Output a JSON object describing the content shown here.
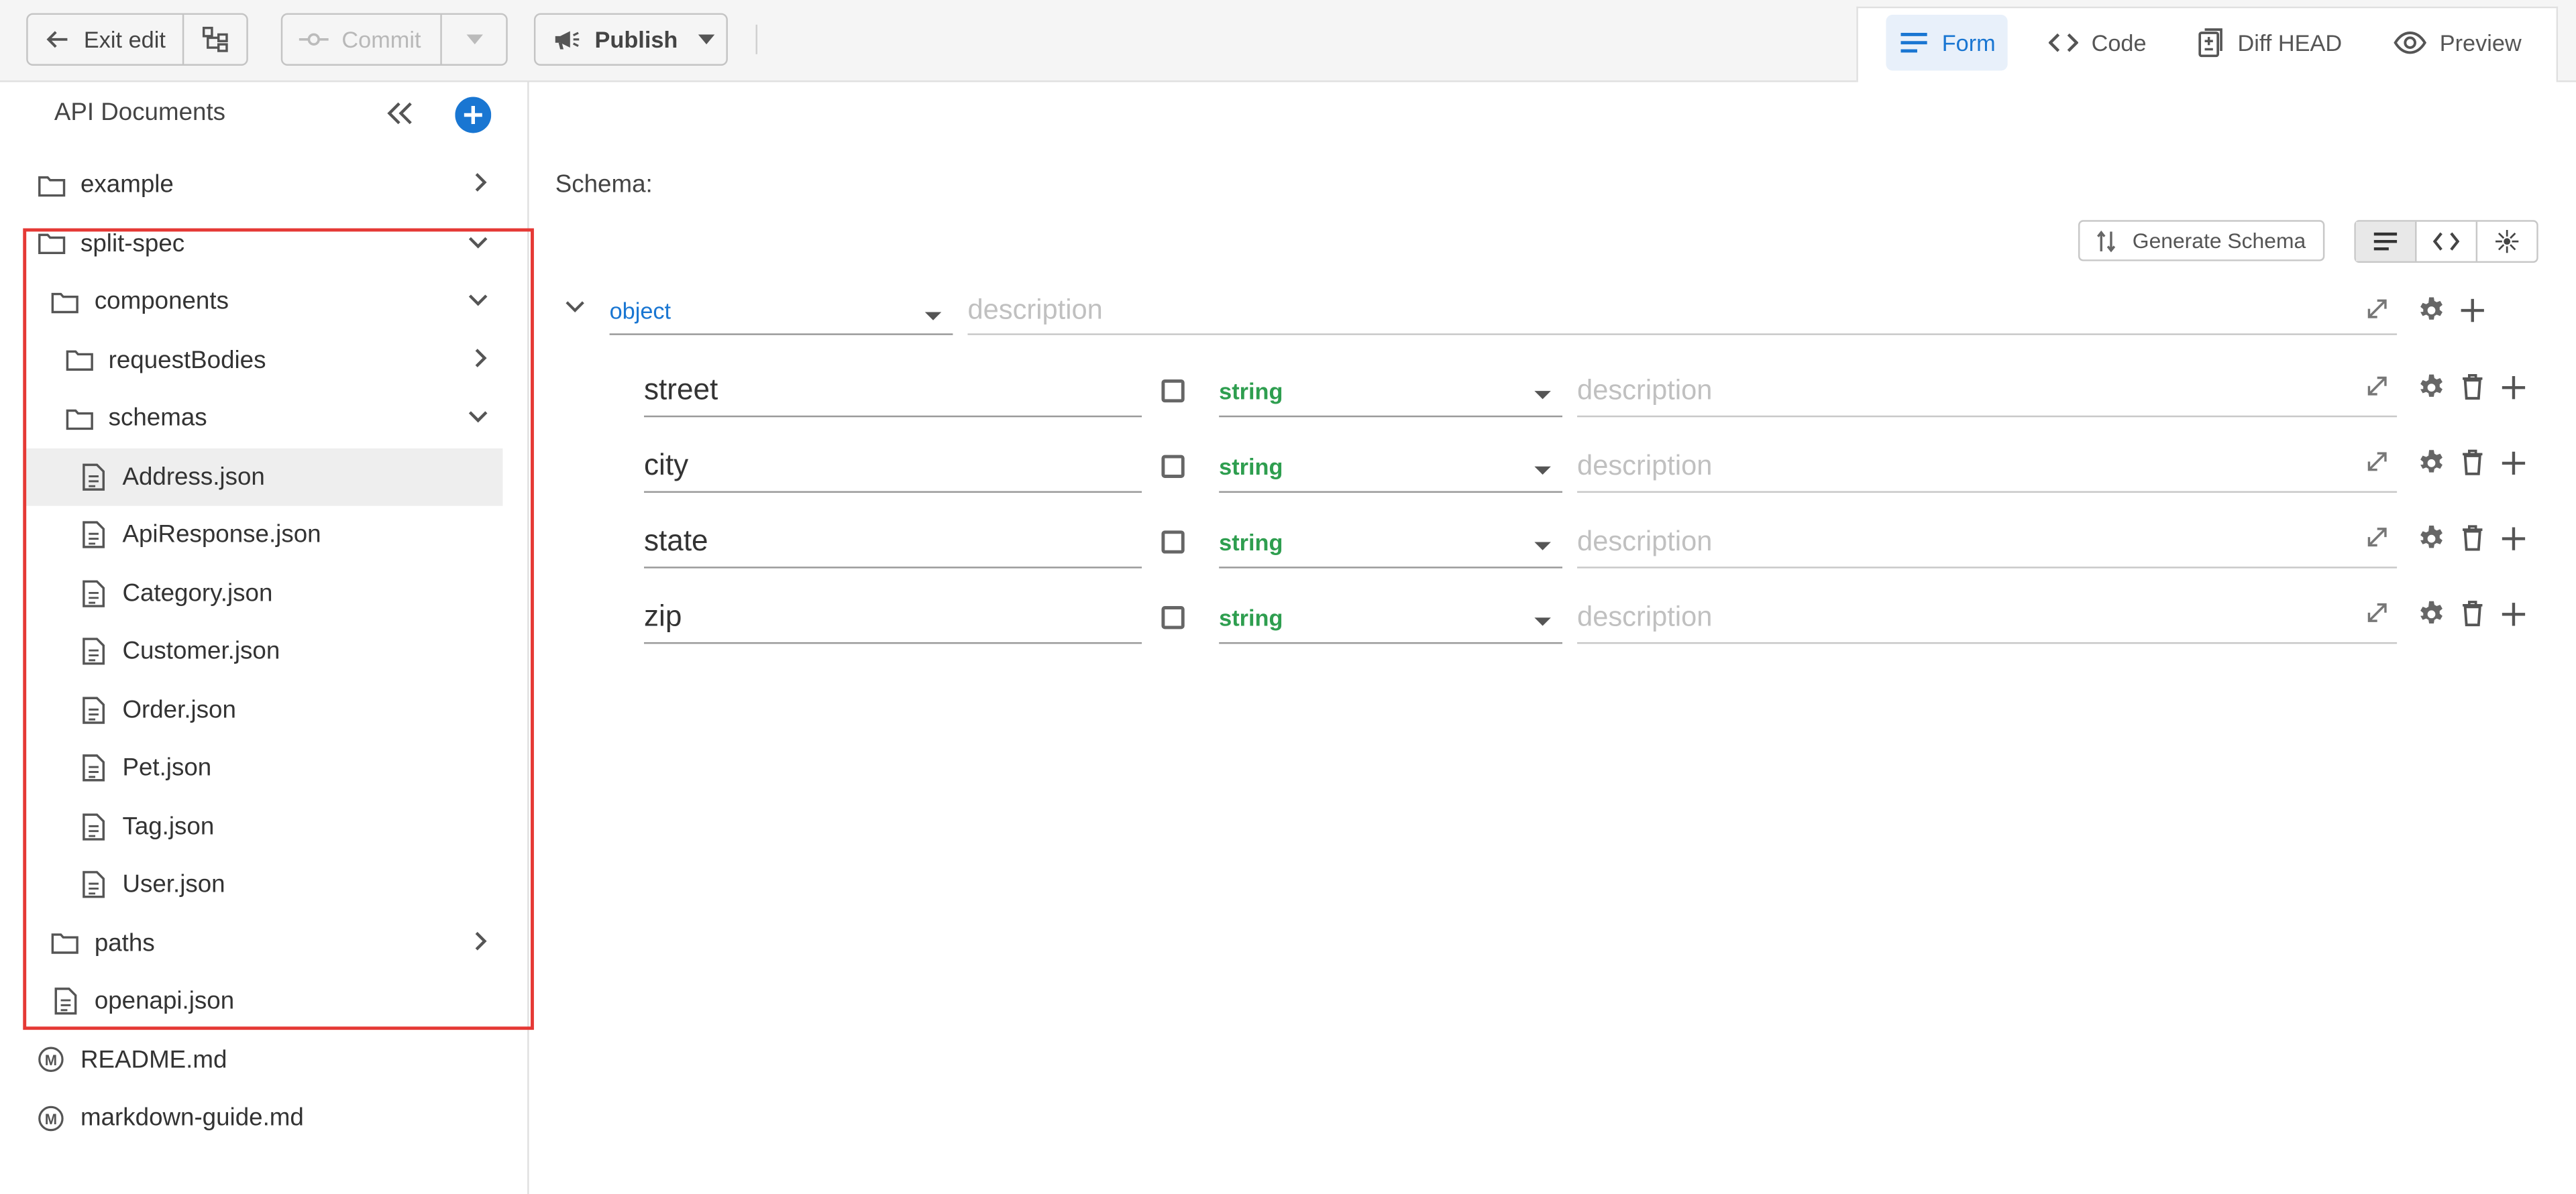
{
  "toolbar": {
    "exit_edit_label": "Exit edit",
    "commit_label": "Commit",
    "publish_label": "Publish"
  },
  "view_tabs": [
    {
      "label": "Form",
      "icon": "lines-icon",
      "active": true
    },
    {
      "label": "Code",
      "icon": "code-icon",
      "active": false
    },
    {
      "label": "Diff HEAD",
      "icon": "diff-icon",
      "active": false
    },
    {
      "label": "Preview",
      "icon": "eye-icon",
      "active": false
    }
  ],
  "sidebar": {
    "title": "API Documents",
    "tree": [
      {
        "label": "example",
        "type": "folder",
        "expanded": false
      },
      {
        "label": "split-spec",
        "type": "folder",
        "expanded": true
      },
      {
        "label": "components",
        "type": "folder",
        "expanded": true
      },
      {
        "label": "requestBodies",
        "type": "folder",
        "expanded": false
      },
      {
        "label": "schemas",
        "type": "folder",
        "expanded": true
      },
      {
        "label": "Address.json",
        "type": "file",
        "selected": true
      },
      {
        "label": "ApiResponse.json",
        "type": "file"
      },
      {
        "label": "Category.json",
        "type": "file"
      },
      {
        "label": "Customer.json",
        "type": "file"
      },
      {
        "label": "Order.json",
        "type": "file"
      },
      {
        "label": "Pet.json",
        "type": "file"
      },
      {
        "label": "Tag.json",
        "type": "file"
      },
      {
        "label": "User.json",
        "type": "file"
      },
      {
        "label": "paths",
        "type": "folder",
        "expanded": false
      },
      {
        "label": "openapi.json",
        "type": "file"
      },
      {
        "label": "README.md",
        "type": "markdown"
      },
      {
        "label": "markdown-guide.md",
        "type": "markdown"
      }
    ]
  },
  "editor": {
    "schema_label": "Schema:",
    "generate_label": "Generate Schema",
    "root": {
      "type": "object",
      "description_placeholder": "description"
    },
    "properties": [
      {
        "name": "street",
        "type": "string",
        "required": false,
        "description_placeholder": "description"
      },
      {
        "name": "city",
        "type": "string",
        "required": false,
        "description_placeholder": "description"
      },
      {
        "name": "state",
        "type": "string",
        "required": false,
        "description_placeholder": "description"
      },
      {
        "name": "zip",
        "type": "string",
        "required": false,
        "description_placeholder": "description"
      }
    ]
  },
  "colors": {
    "accent": "#1976d2",
    "type_object": "#1976d2",
    "type_string": "#2e9e4f",
    "highlight_border": "#e53935"
  }
}
